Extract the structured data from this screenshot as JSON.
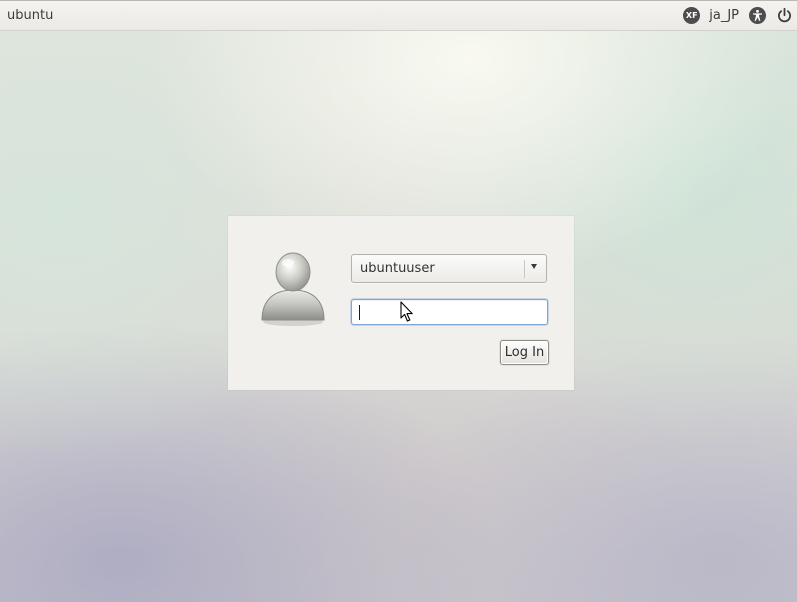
{
  "panel": {
    "hostname": "ubuntu",
    "keyboard_layout_icon_text": "XF",
    "locale": "ja_JP",
    "icons": {
      "keyboard": "keyboard-layout-icon",
      "accessibility": "accessibility-icon",
      "power": "power-icon"
    }
  },
  "login": {
    "avatar_icon": "user-avatar-icon",
    "selected_user": "ubuntuuser",
    "password_value": "",
    "password_placeholder": "",
    "login_button_label": "Log In"
  },
  "colors": {
    "panel_background": "#efeeea",
    "login_box_background": "#f1f0ed",
    "focus_ring": "#7fa7d6",
    "panel_icon": "#4d4d4d"
  }
}
